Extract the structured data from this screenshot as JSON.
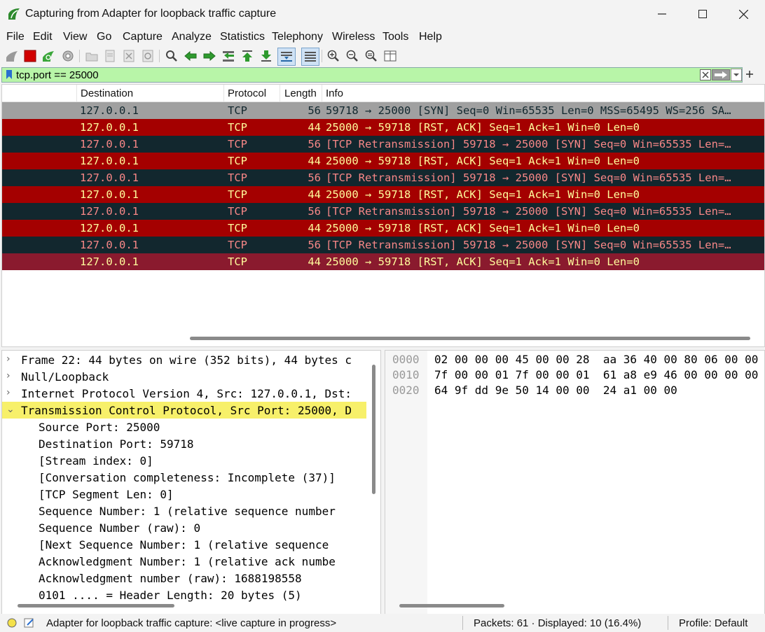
{
  "window": {
    "title": "Capturing from Adapter for loopback traffic capture",
    "controls": [
      "─",
      "☐",
      "✕"
    ]
  },
  "menu": [
    "File",
    "Edit",
    "View",
    "Go",
    "Capture",
    "Analyze",
    "Statistics",
    "Telephony",
    "Wireless",
    "Tools",
    "Help"
  ],
  "filter": {
    "value": "tcp.port == 25000"
  },
  "packet_list": {
    "columns": [
      "Destination",
      "Protocol",
      "Length",
      "Info"
    ],
    "rows": [
      {
        "dst": "127.0.0.1",
        "proto": "TCP",
        "len": "56",
        "info": "59718 → 25000 [SYN] Seq=0 Win=65535 Len=0 MSS=65495 WS=256 SA…",
        "bg": "#a0a0a0",
        "fg": "#12272e"
      },
      {
        "dst": "127.0.0.1",
        "proto": "TCP",
        "len": "44",
        "info": "25000 → 59718 [RST, ACK] Seq=1 Ack=1 Win=0 Len=0",
        "bg": "#a40000",
        "fg": "#fffc9c"
      },
      {
        "dst": "127.0.0.1",
        "proto": "TCP",
        "len": "56",
        "info": "[TCP Retransmission] 59718 → 25000 [SYN] Seq=0 Win=65535 Len=…",
        "bg": "#12272e",
        "fg": "#f78787"
      },
      {
        "dst": "127.0.0.1",
        "proto": "TCP",
        "len": "44",
        "info": "25000 → 59718 [RST, ACK] Seq=1 Ack=1 Win=0 Len=0",
        "bg": "#a40000",
        "fg": "#fffc9c"
      },
      {
        "dst": "127.0.0.1",
        "proto": "TCP",
        "len": "56",
        "info": "[TCP Retransmission] 59718 → 25000 [SYN] Seq=0 Win=65535 Len=…",
        "bg": "#12272e",
        "fg": "#f78787"
      },
      {
        "dst": "127.0.0.1",
        "proto": "TCP",
        "len": "44",
        "info": "25000 → 59718 [RST, ACK] Seq=1 Ack=1 Win=0 Len=0",
        "bg": "#a40000",
        "fg": "#fffc9c"
      },
      {
        "dst": "127.0.0.1",
        "proto": "TCP",
        "len": "56",
        "info": "[TCP Retransmission] 59718 → 25000 [SYN] Seq=0 Win=65535 Len=…",
        "bg": "#12272e",
        "fg": "#f78787"
      },
      {
        "dst": "127.0.0.1",
        "proto": "TCP",
        "len": "44",
        "info": "25000 → 59718 [RST, ACK] Seq=1 Ack=1 Win=0 Len=0",
        "bg": "#a40000",
        "fg": "#fffc9c"
      },
      {
        "dst": "127.0.0.1",
        "proto": "TCP",
        "len": "56",
        "info": "[TCP Retransmission] 59718 → 25000 [SYN] Seq=0 Win=65535 Len=…",
        "bg": "#12272e",
        "fg": "#f78787"
      },
      {
        "dst": "127.0.0.1",
        "proto": "TCP",
        "len": "44",
        "info": "25000 → 59718 [RST, ACK] Seq=1 Ack=1 Win=0 Len=0",
        "bg": "#8a1a2e",
        "fg": "#fffc9c",
        "selected": true
      }
    ]
  },
  "details": [
    {
      "chevron": "›",
      "text": "Frame 22: 44 bytes on wire (352 bits), 44 bytes c",
      "indent": 0
    },
    {
      "chevron": "›",
      "text": "Null/Loopback",
      "indent": 0
    },
    {
      "chevron": "›",
      "text": "Internet Protocol Version 4, Src: 127.0.0.1, Dst:",
      "indent": 0
    },
    {
      "chevron": "⌄",
      "text": "Transmission Control Protocol, Src Port: 25000, D",
      "indent": 0,
      "highlight": true
    },
    {
      "chevron": "",
      "text": "Source Port: 25000",
      "indent": 1
    },
    {
      "chevron": "",
      "text": "Destination Port: 59718",
      "indent": 1
    },
    {
      "chevron": "",
      "text": "[Stream index: 0]",
      "indent": 1
    },
    {
      "chevron": "",
      "text": "[Conversation completeness: Incomplete (37)]",
      "indent": 1
    },
    {
      "chevron": "",
      "text": "[TCP Segment Len: 0]",
      "indent": 1
    },
    {
      "chevron": "",
      "text": "Sequence Number: 1    (relative sequence number",
      "indent": 1
    },
    {
      "chevron": "",
      "text": "Sequence Number (raw): 0",
      "indent": 1
    },
    {
      "chevron": "",
      "text": "[Next Sequence Number: 1    (relative sequence",
      "indent": 1
    },
    {
      "chevron": "",
      "text": "Acknowledgment Number: 1    (relative ack numbe",
      "indent": 1
    },
    {
      "chevron": "",
      "text": "Acknowledgment number (raw): 1688198558",
      "indent": 1
    },
    {
      "chevron": "",
      "text": "0101 .... = Header Length: 20 bytes (5)",
      "indent": 1
    }
  ],
  "hex": [
    {
      "offset": "0000",
      "bytes": "02 00 00 00 45 00 00 28  aa 36 40 00 80 06 00 00"
    },
    {
      "offset": "0010",
      "bytes": "7f 00 00 01 7f 00 00 01  61 a8 e9 46 00 00 00 00"
    },
    {
      "offset": "0020",
      "bytes": "64 9f dd 9e 50 14 00 00  24 a1 00 00"
    }
  ],
  "status": {
    "capture": "Adapter for loopback traffic capture: <live capture in progress>",
    "packets": "Packets: 61 · Displayed: 10 (16.4%)",
    "profile": "Profile: Default"
  },
  "colors": {
    "filter_valid_bg": "#b8f5a8",
    "highlight_field": "#f7f06a"
  },
  "icons": [
    "shark-fin-icon",
    "stop-icon",
    "restart-icon",
    "gear-icon",
    "open-icon",
    "save-icon",
    "close-file-icon",
    "reload-icon",
    "find-icon",
    "back-arrow-icon",
    "forward-arrow-icon",
    "go-to-icon",
    "first-packet-icon",
    "last-packet-icon",
    "autoscroll-icon",
    "colorize-icon",
    "zoom-in-icon",
    "zoom-out-icon",
    "zoom-reset-icon",
    "resize-columns-icon"
  ]
}
